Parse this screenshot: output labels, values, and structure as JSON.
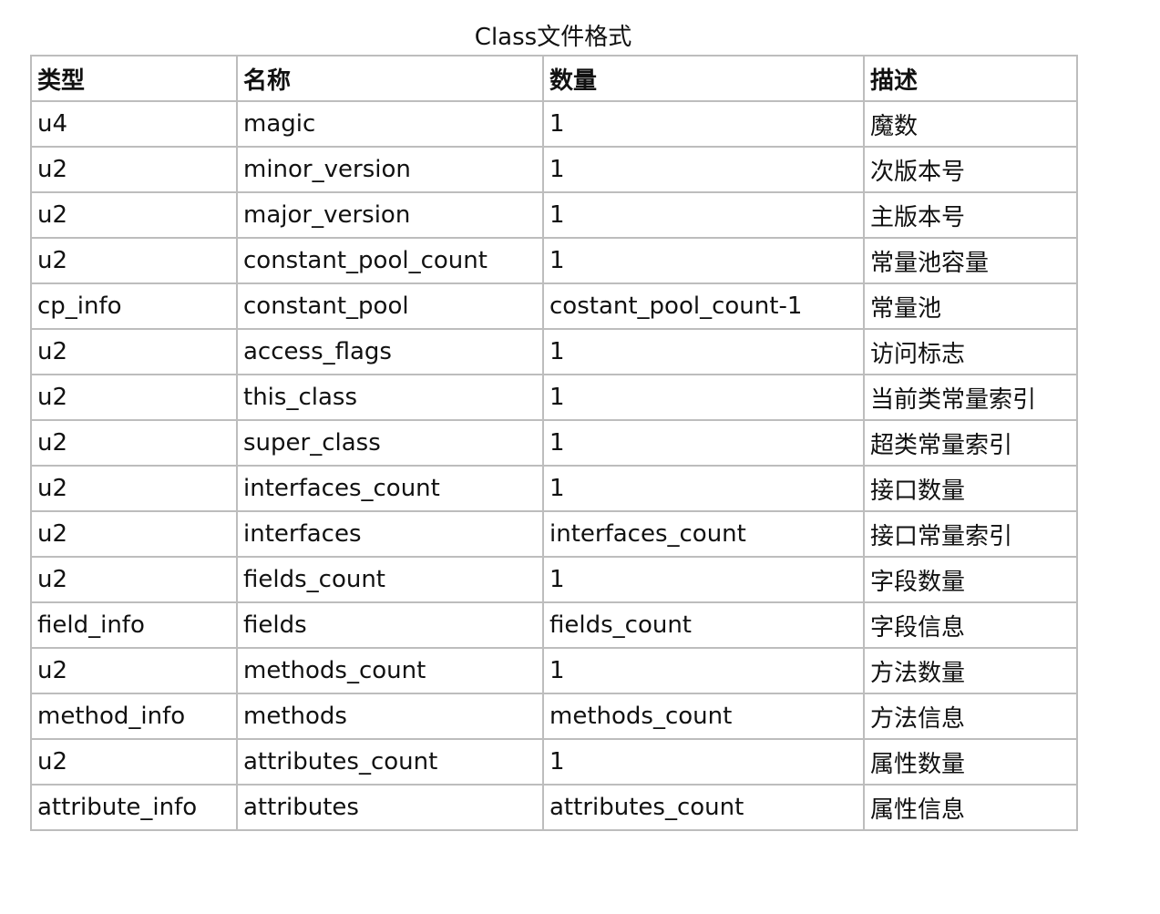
{
  "table": {
    "caption": "Class文件格式",
    "headers": [
      "类型",
      "名称",
      "数量",
      "描述"
    ],
    "rows": [
      [
        "u4",
        "magic",
        "1",
        "魔数"
      ],
      [
        "u2",
        "minor_version",
        "1",
        "次版本号"
      ],
      [
        "u2",
        "major_version",
        "1",
        "主版本号"
      ],
      [
        "u2",
        "constant_pool_count",
        "1",
        "常量池容量"
      ],
      [
        "cp_info",
        "constant_pool",
        "costant_pool_count-1",
        "常量池"
      ],
      [
        "u2",
        "access_flags",
        "1",
        "访问标志"
      ],
      [
        "u2",
        "this_class",
        "1",
        "当前类常量索引"
      ],
      [
        "u2",
        "super_class",
        "1",
        "超类常量索引"
      ],
      [
        "u2",
        "interfaces_count",
        "1",
        "接口数量"
      ],
      [
        "u2",
        "interfaces",
        "interfaces_count",
        "接口常量索引"
      ],
      [
        "u2",
        "fields_count",
        "1",
        "字段数量"
      ],
      [
        "field_info",
        "fields",
        "fields_count",
        "字段信息"
      ],
      [
        "u2",
        "methods_count",
        "1",
        "方法数量"
      ],
      [
        "method_info",
        "methods",
        "methods_count",
        "方法信息"
      ],
      [
        "u2",
        "attributes_count",
        "1",
        "属性数量"
      ],
      [
        "attribute_info",
        "attributes",
        "attributes_count",
        "属性信息"
      ]
    ]
  }
}
